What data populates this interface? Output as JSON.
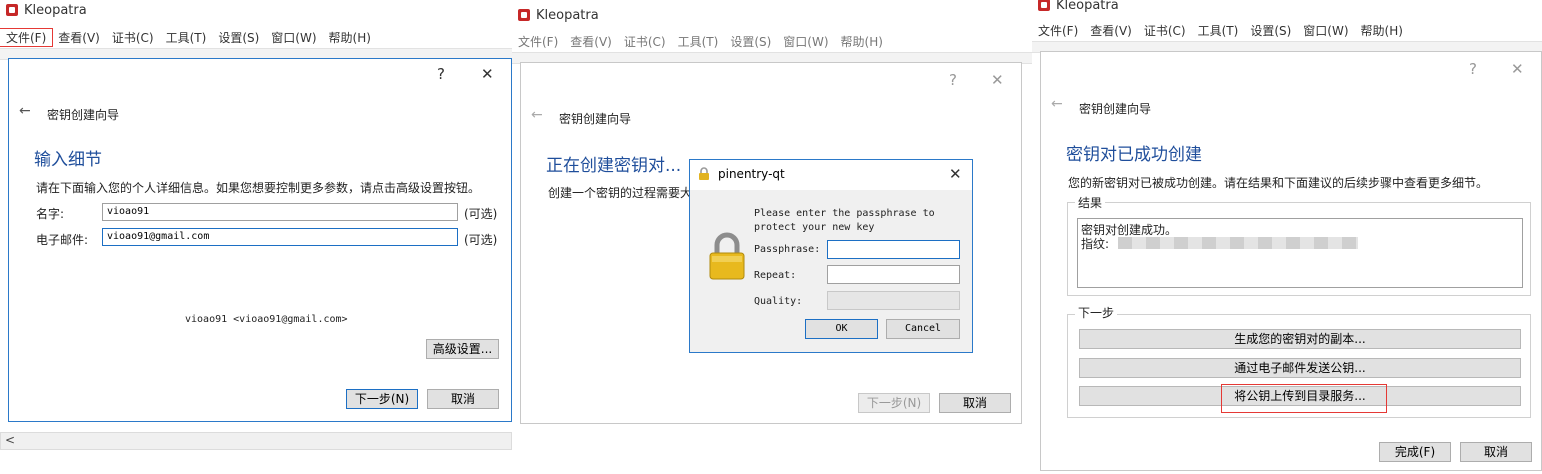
{
  "app": {
    "title": "Kleopatra"
  },
  "menu": [
    "文件(F)",
    "查看(V)",
    "证书(C)",
    "工具(T)",
    "设置(S)",
    "窗口(W)",
    "帮助(H)"
  ],
  "controls": {
    "help": "?",
    "close": "✕",
    "back": "←"
  },
  "panel1": {
    "wizard_title": "密钥创建向导",
    "heading": "输入细节",
    "description": "请在下面输入您的个人详细信息。如果您想要控制更多参数，请点击高级设置按钮。",
    "name_label": "名字:",
    "name_value": "vioao91",
    "email_label": "电子邮件:",
    "email_value": "vioao91@gmail.com",
    "optional": "(可选)",
    "preview": "vioao91 <vioao91@gmail.com>",
    "advanced_button": "高级设置...",
    "next_button": "下一步(N)",
    "cancel_button": "取消",
    "scroll_left": "<"
  },
  "panel2": {
    "wizard_title": "密钥创建向导",
    "heading": "正在创建密钥对...",
    "description": "创建一个密钥的过程需要大",
    "next_button": "下一步(N)",
    "cancel_button": "取消",
    "pinentry": {
      "title": "pinentry-qt",
      "message_line1": "Please enter the passphrase to",
      "message_line2": "protect your new key",
      "passphrase_label": "Passphrase:",
      "repeat_label": "Repeat:",
      "quality_label": "Quality:",
      "ok_button": "OK",
      "cancel_button": "Cancel"
    }
  },
  "panel3": {
    "wizard_title": "密钥创建向导",
    "heading": "密钥对已成功创建",
    "description": "您的新密钥对已被成功创建。请在结果和下面建议的后续步骤中查看更多细节。",
    "results_label": "结果",
    "results_line1": "密钥对创建成功。",
    "results_line2": "指纹:",
    "next_steps_label": "下一步",
    "backup_button": "生成您的密钥对的副本...",
    "email_button": "通过电子邮件发送公钥...",
    "upload_button": "将公钥上传到目录服务...",
    "finish_button": "完成(F)",
    "cancel_button": "取消"
  },
  "colors": {
    "accent": "#1f4e9b",
    "highlight": "#e53935",
    "focus": "#1c6fc4"
  }
}
